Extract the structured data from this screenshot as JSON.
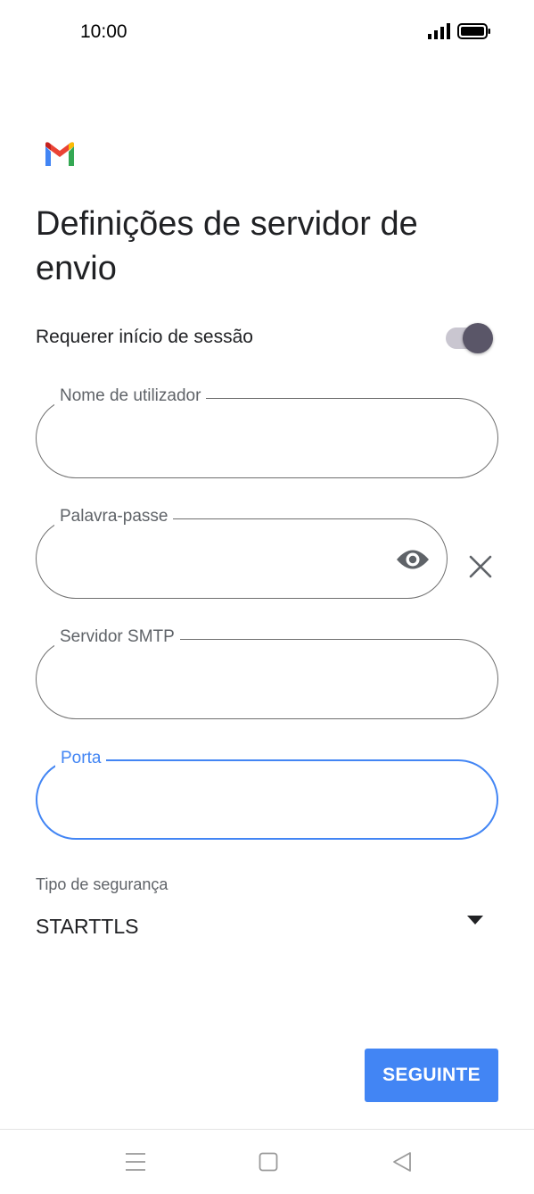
{
  "status_bar": {
    "time": "10:00",
    "icons": [
      "signal-icon",
      "battery-icon"
    ]
  },
  "header": {
    "logo": "gmail-logo",
    "title": "Definições de servidor de envio"
  },
  "login_toggle": {
    "label": "Requerer início de sessão",
    "on": true
  },
  "fields": {
    "username": {
      "label": "Nome de utilizador",
      "value": ""
    },
    "password": {
      "label": "Palavra-passe",
      "value": "",
      "icons": [
        "eye-icon",
        "close-icon"
      ]
    },
    "smtp_server": {
      "label": "Servidor SMTP",
      "value": ""
    },
    "port": {
      "label": "Porta",
      "value": "",
      "focused": true
    }
  },
  "security": {
    "label": "Tipo de segurança",
    "selected": "STARTTLS",
    "icon": "dropdown-icon"
  },
  "actions": {
    "next_label": "SEGUINTE"
  },
  "nav_bar": {
    "icons": [
      "menu-icon",
      "home-icon",
      "back-icon"
    ]
  },
  "colors": {
    "accent": "#4285f4",
    "toggle_thumb": "#5a5668",
    "toggle_track": "#c9c6d0",
    "outline": "#6f6f6f"
  }
}
